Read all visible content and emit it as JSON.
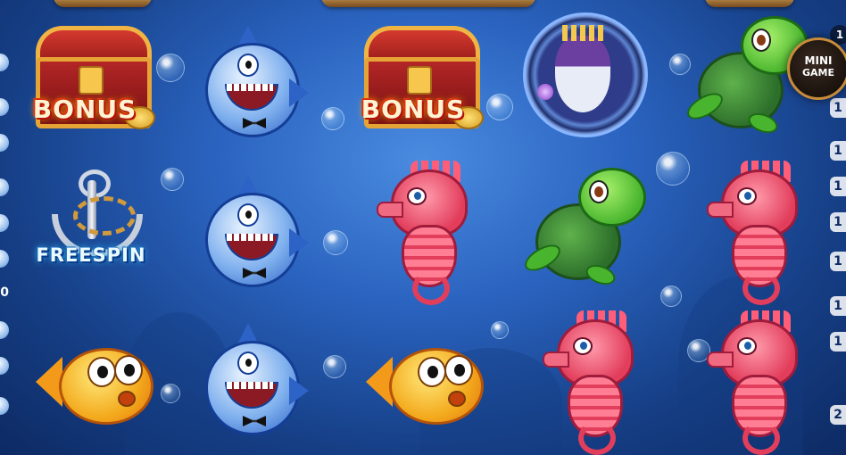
{
  "game": {
    "mini_game": {
      "line1": "MINI",
      "line2": "GAME",
      "badge": "1"
    },
    "side_numbers_right": [
      "1",
      "1",
      "1",
      "1",
      "1",
      "1",
      "1",
      "2"
    ],
    "side_number_left": "0",
    "symbols": {
      "bonus": "BONUS",
      "freespin": "FREESPIN"
    },
    "grid": [
      [
        "chest",
        "shark",
        "chest",
        "wizard",
        "turtle"
      ],
      [
        "anchor",
        "shark",
        "seahorse",
        "turtle",
        "seahorse"
      ],
      [
        "fish",
        "shark",
        "fish",
        "seahorse",
        "seahorse"
      ]
    ]
  },
  "colors": {
    "background_center": "#4a8be0",
    "background_edge": "#0d2a63",
    "bonus_text": "#fff4d1",
    "bonus_outline": "#b3120a",
    "freespin_text": "#e9fbff",
    "freespin_outline": "#0a3c8a"
  }
}
